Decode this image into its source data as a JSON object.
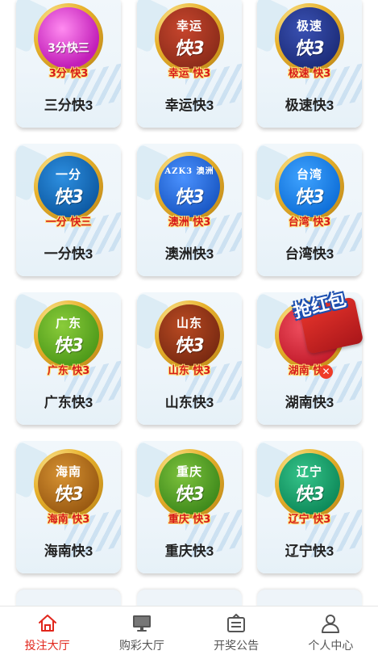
{
  "games": [
    {
      "name": "三分快3",
      "badge_top": "",
      "badge_main": "3分快三",
      "caption": "3分 快3",
      "colors": {
        "inner": "#c21eb9",
        "inner2": "#ff6de8"
      }
    },
    {
      "name": "幸运快3",
      "badge_top": "幸运",
      "badge_main": "快3",
      "caption": "幸运 快3",
      "colors": {
        "inner": "#8c2c1a",
        "inner2": "#c7452d"
      }
    },
    {
      "name": "极速快3",
      "badge_top": "极速",
      "badge_main": "快3",
      "caption": "极速 快3",
      "colors": {
        "inner": "#1d2d7a",
        "inner2": "#3a51b3"
      }
    },
    {
      "name": "一分快3",
      "badge_top": "一分",
      "badge_main": "快3",
      "caption": "一分 快三",
      "colors": {
        "inner": "#0e5aa3",
        "inner2": "#2d8fe0"
      }
    },
    {
      "name": "澳洲快3",
      "badge_top": "AZK3 澳洲",
      "badge_main": "快3",
      "caption": "澳洲 快3",
      "colors": {
        "inner": "#1a58c4",
        "inner2": "#4b92ff"
      }
    },
    {
      "name": "台湾快3",
      "badge_top": "台湾",
      "badge_main": "快3",
      "caption": "台湾 快3",
      "colors": {
        "inner": "#0f6fd8",
        "inner2": "#3fa3ff"
      }
    },
    {
      "name": "广东快3",
      "badge_top": "广东",
      "badge_main": "快3",
      "caption": "广东 快3",
      "colors": {
        "inner": "#4e9a1a",
        "inner2": "#8acc3a"
      }
    },
    {
      "name": "山东快3",
      "badge_top": "山东",
      "badge_main": "快3",
      "caption": "山东 快3",
      "colors": {
        "inner": "#7a2a12",
        "inner2": "#b94a22"
      }
    },
    {
      "name": "湖南快3",
      "badge_top": "",
      "badge_main": "",
      "caption": "湖南 快3",
      "colors": {
        "inner": "#c31c2c",
        "inner2": "#f05060"
      }
    },
    {
      "name": "海南快3",
      "badge_top": "海南",
      "badge_main": "快3",
      "caption": "海南 快3",
      "colors": {
        "inner": "#9a5a12",
        "inner2": "#d69232"
      }
    },
    {
      "name": "重庆快3",
      "badge_top": "重庆",
      "badge_main": "快3",
      "caption": "重庆 快3",
      "colors": {
        "inner": "#3f8a1c",
        "inner2": "#7dc23c"
      }
    },
    {
      "name": "辽宁快3",
      "badge_top": "辽宁",
      "badge_main": "快3",
      "caption": "辽宁 快3",
      "colors": {
        "inner": "#0e8a5a",
        "inner2": "#36c48a"
      }
    }
  ],
  "promo": {
    "text": "抢红包",
    "close": "✕"
  },
  "tabbar": {
    "items": [
      {
        "label": "投注大厅",
        "icon": "home-icon",
        "active": true
      },
      {
        "label": "购彩大厅",
        "icon": "monitor-icon",
        "active": false
      },
      {
        "label": "开奖公告",
        "icon": "announcement-icon",
        "active": false
      },
      {
        "label": "个人中心",
        "icon": "user-icon",
        "active": false
      }
    ],
    "active_color": "#e1261c"
  }
}
